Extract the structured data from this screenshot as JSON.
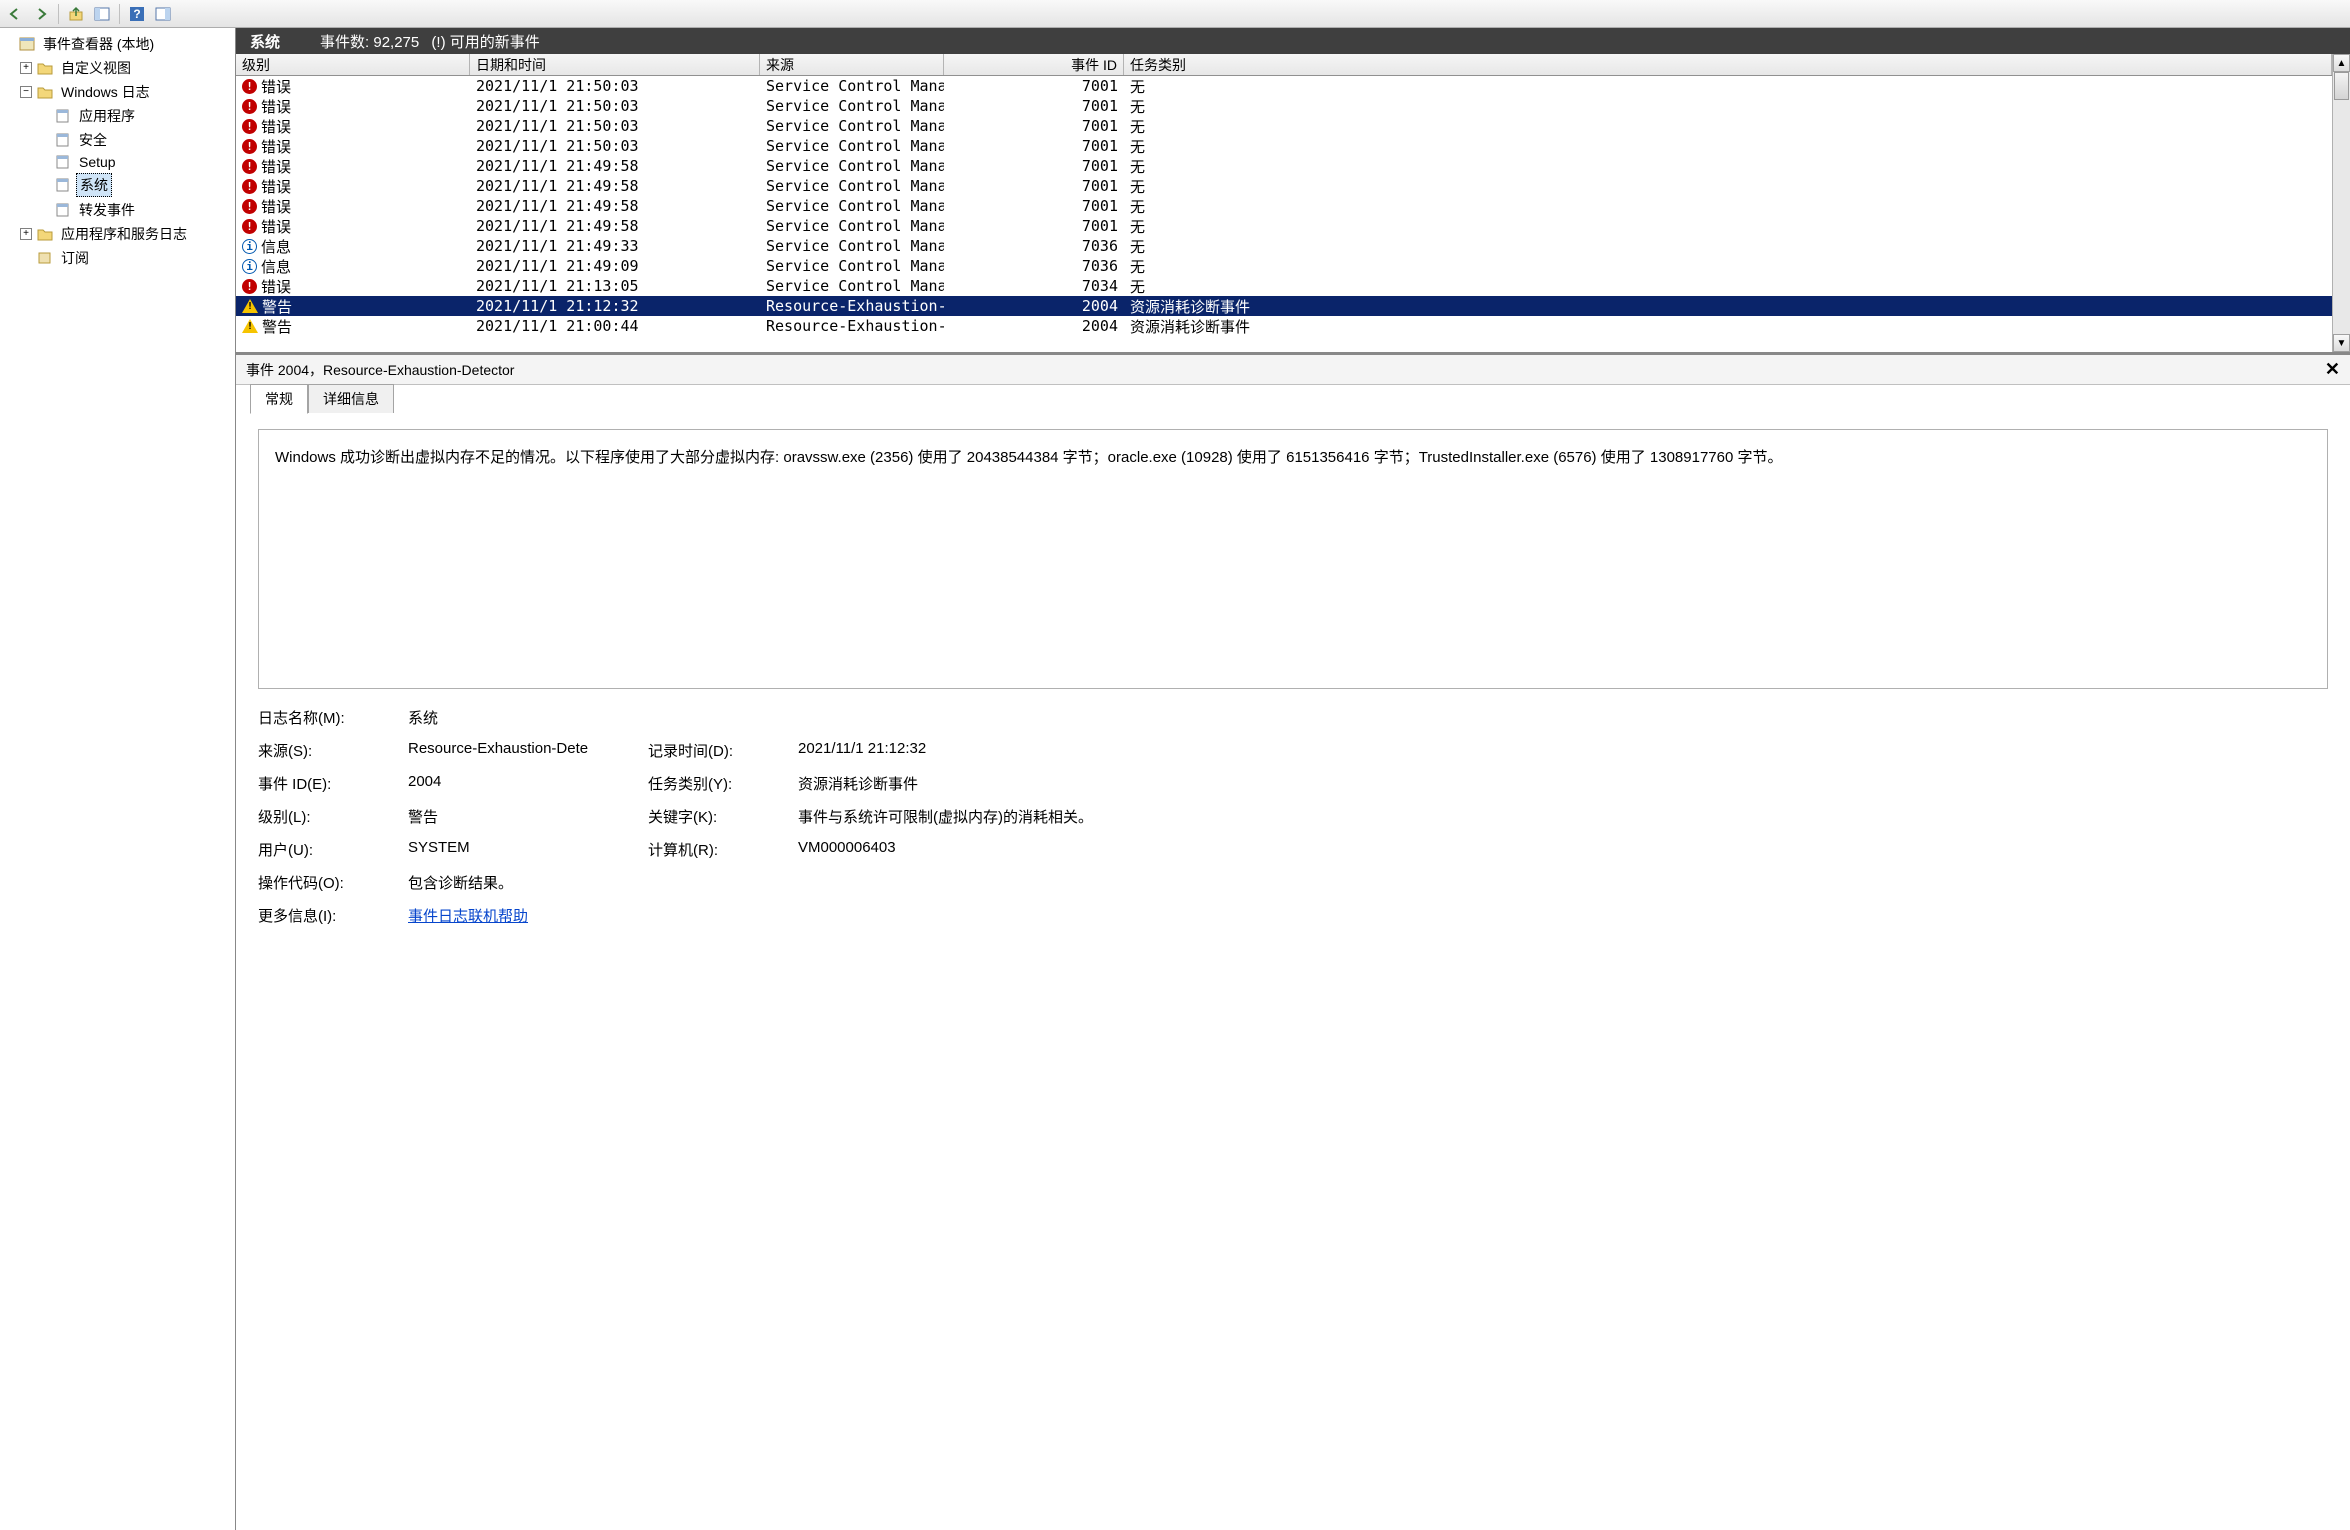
{
  "toolbar": {
    "back": "←",
    "forward": "→"
  },
  "tree": {
    "root": "事件查看器 (本地)",
    "customViews": "自定义视图",
    "windowsLogs": "Windows 日志",
    "application": "应用程序",
    "security": "安全",
    "setup": "Setup",
    "system": "系统",
    "forwarded": "转发事件",
    "appServices": "应用程序和服务日志",
    "subscriptions": "订阅"
  },
  "header": {
    "title": "系统",
    "countsLabel": "事件数:",
    "counts": "92,275",
    "newEvents": "(!) 可用的新事件"
  },
  "columns": {
    "level": "级别",
    "datetime": "日期和时间",
    "source": "来源",
    "eventId": "事件 ID",
    "taskCategory": "任务类别"
  },
  "rows": [
    {
      "type": "error",
      "level": "错误",
      "dt": "2021/11/1 21:50:03",
      "src": "Service Control Manager",
      "id": "7001",
      "cat": "无"
    },
    {
      "type": "error",
      "level": "错误",
      "dt": "2021/11/1 21:50:03",
      "src": "Service Control Manager",
      "id": "7001",
      "cat": "无"
    },
    {
      "type": "error",
      "level": "错误",
      "dt": "2021/11/1 21:50:03",
      "src": "Service Control Manager",
      "id": "7001",
      "cat": "无"
    },
    {
      "type": "error",
      "level": "错误",
      "dt": "2021/11/1 21:50:03",
      "src": "Service Control Manager",
      "id": "7001",
      "cat": "无"
    },
    {
      "type": "error",
      "level": "错误",
      "dt": "2021/11/1 21:49:58",
      "src": "Service Control Manager",
      "id": "7001",
      "cat": "无"
    },
    {
      "type": "error",
      "level": "错误",
      "dt": "2021/11/1 21:49:58",
      "src": "Service Control Manager",
      "id": "7001",
      "cat": "无"
    },
    {
      "type": "error",
      "level": "错误",
      "dt": "2021/11/1 21:49:58",
      "src": "Service Control Manager",
      "id": "7001",
      "cat": "无"
    },
    {
      "type": "error",
      "level": "错误",
      "dt": "2021/11/1 21:49:58",
      "src": "Service Control Manager",
      "id": "7001",
      "cat": "无"
    },
    {
      "type": "info",
      "level": "信息",
      "dt": "2021/11/1 21:49:33",
      "src": "Service Control Manager",
      "id": "7036",
      "cat": "无"
    },
    {
      "type": "info",
      "level": "信息",
      "dt": "2021/11/1 21:49:09",
      "src": "Service Control Manager",
      "id": "7036",
      "cat": "无"
    },
    {
      "type": "error",
      "level": "错误",
      "dt": "2021/11/1 21:13:05",
      "src": "Service Control Manager",
      "id": "7034",
      "cat": "无"
    },
    {
      "type": "warn",
      "level": "警告",
      "dt": "2021/11/1 21:12:32",
      "src": "Resource-Exhaustion-D...",
      "id": "2004",
      "cat": "资源消耗诊断事件",
      "selected": true
    },
    {
      "type": "warn",
      "level": "警告",
      "dt": "2021/11/1 21:00:44",
      "src": "Resource-Exhaustion-D...",
      "id": "2004",
      "cat": "资源消耗诊断事件"
    }
  ],
  "detail": {
    "title": "事件 2004，Resource-Exhaustion-Detector",
    "tabGeneral": "常规",
    "tabDetail": "详细信息",
    "description": "Windows 成功诊断出虚拟内存不足的情况。以下程序使用了大部分虚拟内存: oravssw.exe (2356) 使用了 20438544384 字节；oracle.exe (10928) 使用了 6151356416 字节；TrustedInstaller.exe (6576) 使用了 1308917760 字节。",
    "logNameLabel": "日志名称(M):",
    "logName": "系统",
    "sourceLabel": "来源(S):",
    "source": "Resource-Exhaustion-Dete",
    "loggedLabel": "记录时间(D):",
    "logged": "2021/11/1 21:12:32",
    "eventIdLabel": "事件 ID(E):",
    "eventId": "2004",
    "taskCatLabel": "任务类别(Y):",
    "taskCat": "资源消耗诊断事件",
    "levelLabel": "级别(L):",
    "level": "警告",
    "keywordsLabel": "关键字(K):",
    "keywords": "事件与系统许可限制(虚拟内存)的消耗相关。",
    "userLabel": "用户(U):",
    "user": "SYSTEM",
    "computerLabel": "计算机(R):",
    "computer": "VM000006403",
    "opcodeLabel": "操作代码(O):",
    "opcode": "包含诊断结果。",
    "moreInfoLabel": "更多信息(I):",
    "moreInfo": "事件日志联机帮助"
  }
}
